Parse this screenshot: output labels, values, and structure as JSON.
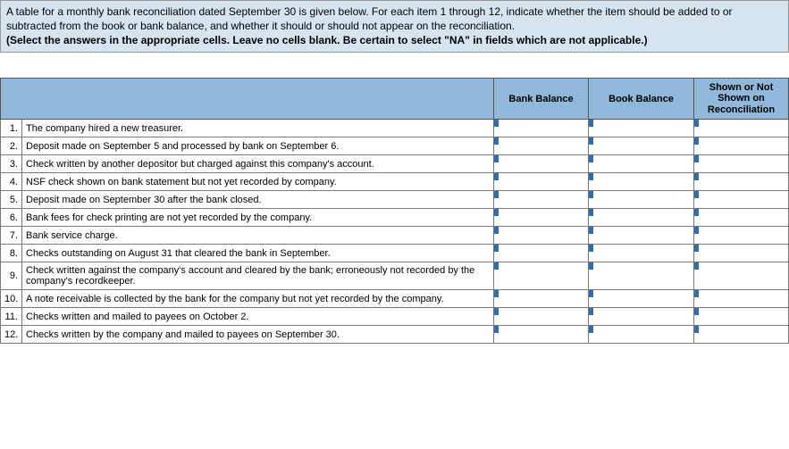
{
  "instructions": {
    "line1": "A table for a monthly bank reconciliation dated September 30 is given below. For each item 1 through 12, indicate whether the item should be added to or subtracted from the book or bank balance, and whether it should or should not appear on the reconciliation.",
    "line2_bold": "(Select the answers in the appropriate cells. Leave no cells blank. Be certain to select \"NA\" in fields which are not applicable.)"
  },
  "headers": {
    "bank": "Bank Balance",
    "book": "Book Balance",
    "shown": "Shown or Not Shown on Reconciliation"
  },
  "rows": [
    {
      "n": "1.",
      "desc": "The company hired a new treasurer."
    },
    {
      "n": "2.",
      "desc": "Deposit made on September 5 and processed by bank on September 6."
    },
    {
      "n": "3.",
      "desc": "Check written by another depositor but charged against this company's account."
    },
    {
      "n": "4.",
      "desc": "NSF check shown on bank statement but not yet recorded by company."
    },
    {
      "n": "5.",
      "desc": "Deposit made on September 30 after the bank closed."
    },
    {
      "n": "6.",
      "desc": "Bank fees for check printing are not yet recorded by the company."
    },
    {
      "n": "7.",
      "desc": "Bank service charge."
    },
    {
      "n": "8.",
      "desc": "Checks outstanding on August 31 that cleared the bank in September."
    },
    {
      "n": "9.",
      "desc": "Check written against the company's account and cleared by the bank; erroneously not recorded by the company's recordkeeper."
    },
    {
      "n": "10.",
      "desc": "A note receivable is collected by the bank for the company but not yet recorded by the company."
    },
    {
      "n": "11.",
      "desc": "Checks written and mailed to payees on October 2."
    },
    {
      "n": "12.",
      "desc": "Checks written by the company and mailed to payees on September 30."
    }
  ]
}
